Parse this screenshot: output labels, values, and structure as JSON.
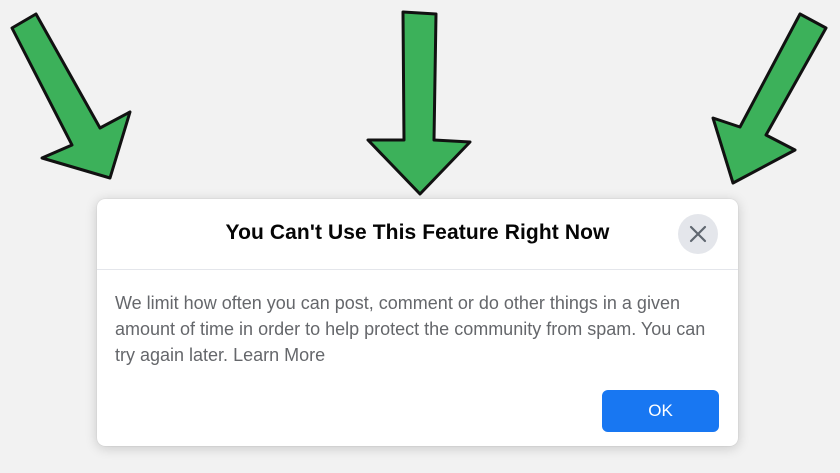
{
  "dialog": {
    "title": "You Can't Use This Feature Right Now",
    "body_text": "We limit how often you can post, comment or do other things in a given amount of time in order to help protect the community from spam. You can try again later.",
    "learn_more_label": "Learn More",
    "ok_label": "OK",
    "close_icon": "close-icon"
  },
  "colors": {
    "arrow_fill": "#3cb15a",
    "arrow_outline": "#111111",
    "primary_button": "#1877f2",
    "close_button_bg": "#e4e6eb",
    "page_background": "#f2f2f2"
  }
}
